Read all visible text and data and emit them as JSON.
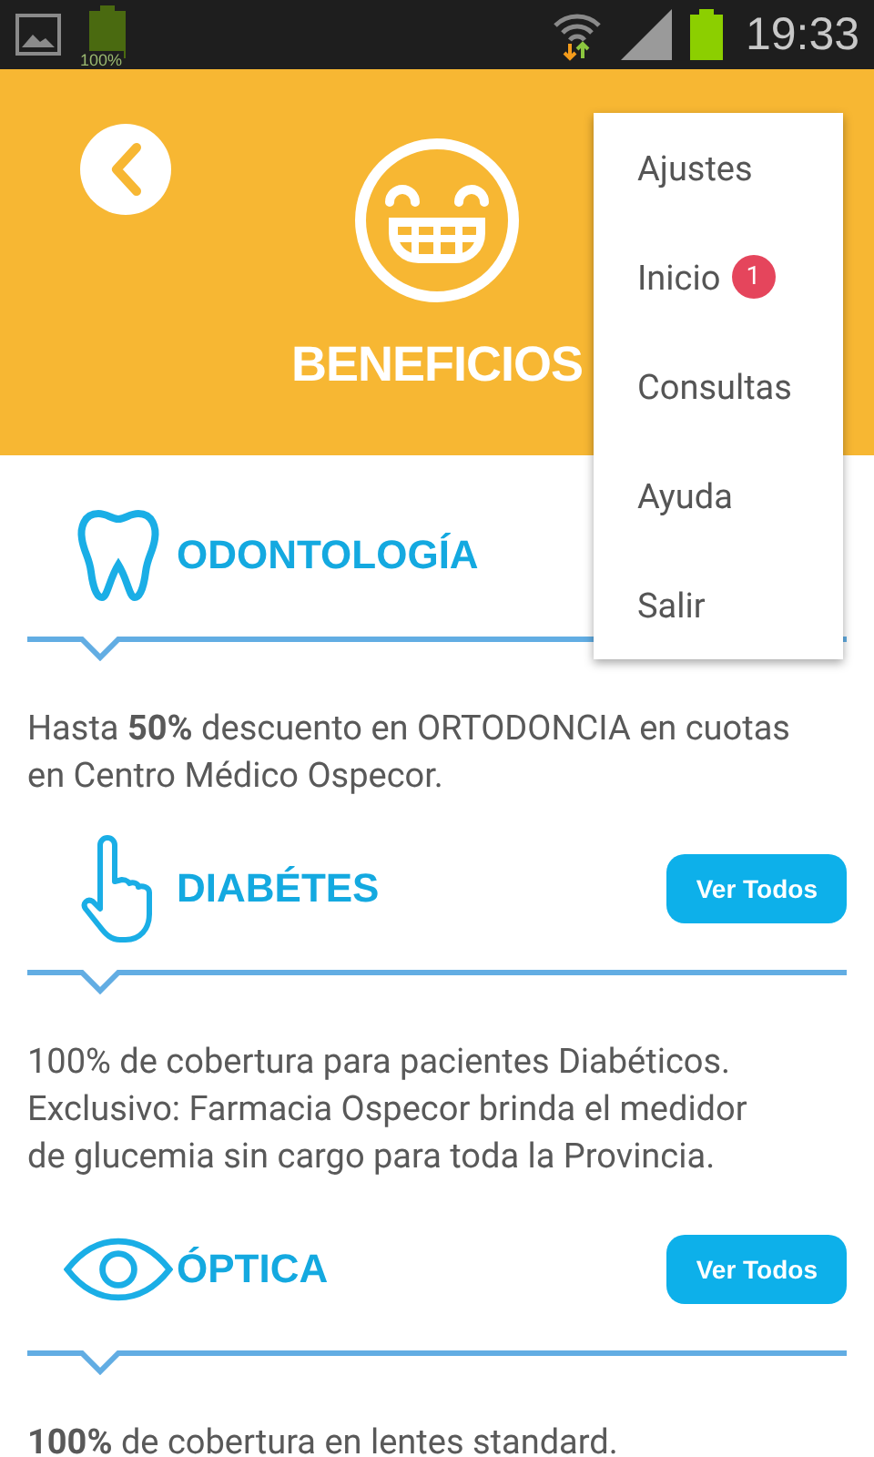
{
  "status_bar": {
    "battery_label": "100%",
    "time": "19:33"
  },
  "header": {
    "title": "BENEFICIOS"
  },
  "sections": [
    {
      "kind": "tooth",
      "title": "ODONTOLOGÍA",
      "description": "Hasta **50%** descuento en ORTODONCIA en cuotas en Centro Médico Ospecor."
    },
    {
      "kind": "hand",
      "title": "DIABÉTES",
      "button": "Ver Todos",
      "description": "100% de cobertura para pacientes Diabéticos. Exclusivo: Farmacia Ospecor brinda el medidor de glucemia sin cargo para toda la Provincia."
    },
    {
      "kind": "eye",
      "title": "ÓPTICA",
      "button": "Ver Todos",
      "description": "**100%** de cobertura en lentes standard."
    }
  ],
  "menu": {
    "items": [
      {
        "label": "Ajustes"
      },
      {
        "label": "Inicio",
        "badge": "1"
      },
      {
        "label": "Consultas"
      },
      {
        "label": "Ayuda"
      },
      {
        "label": "Salir"
      }
    ]
  }
}
